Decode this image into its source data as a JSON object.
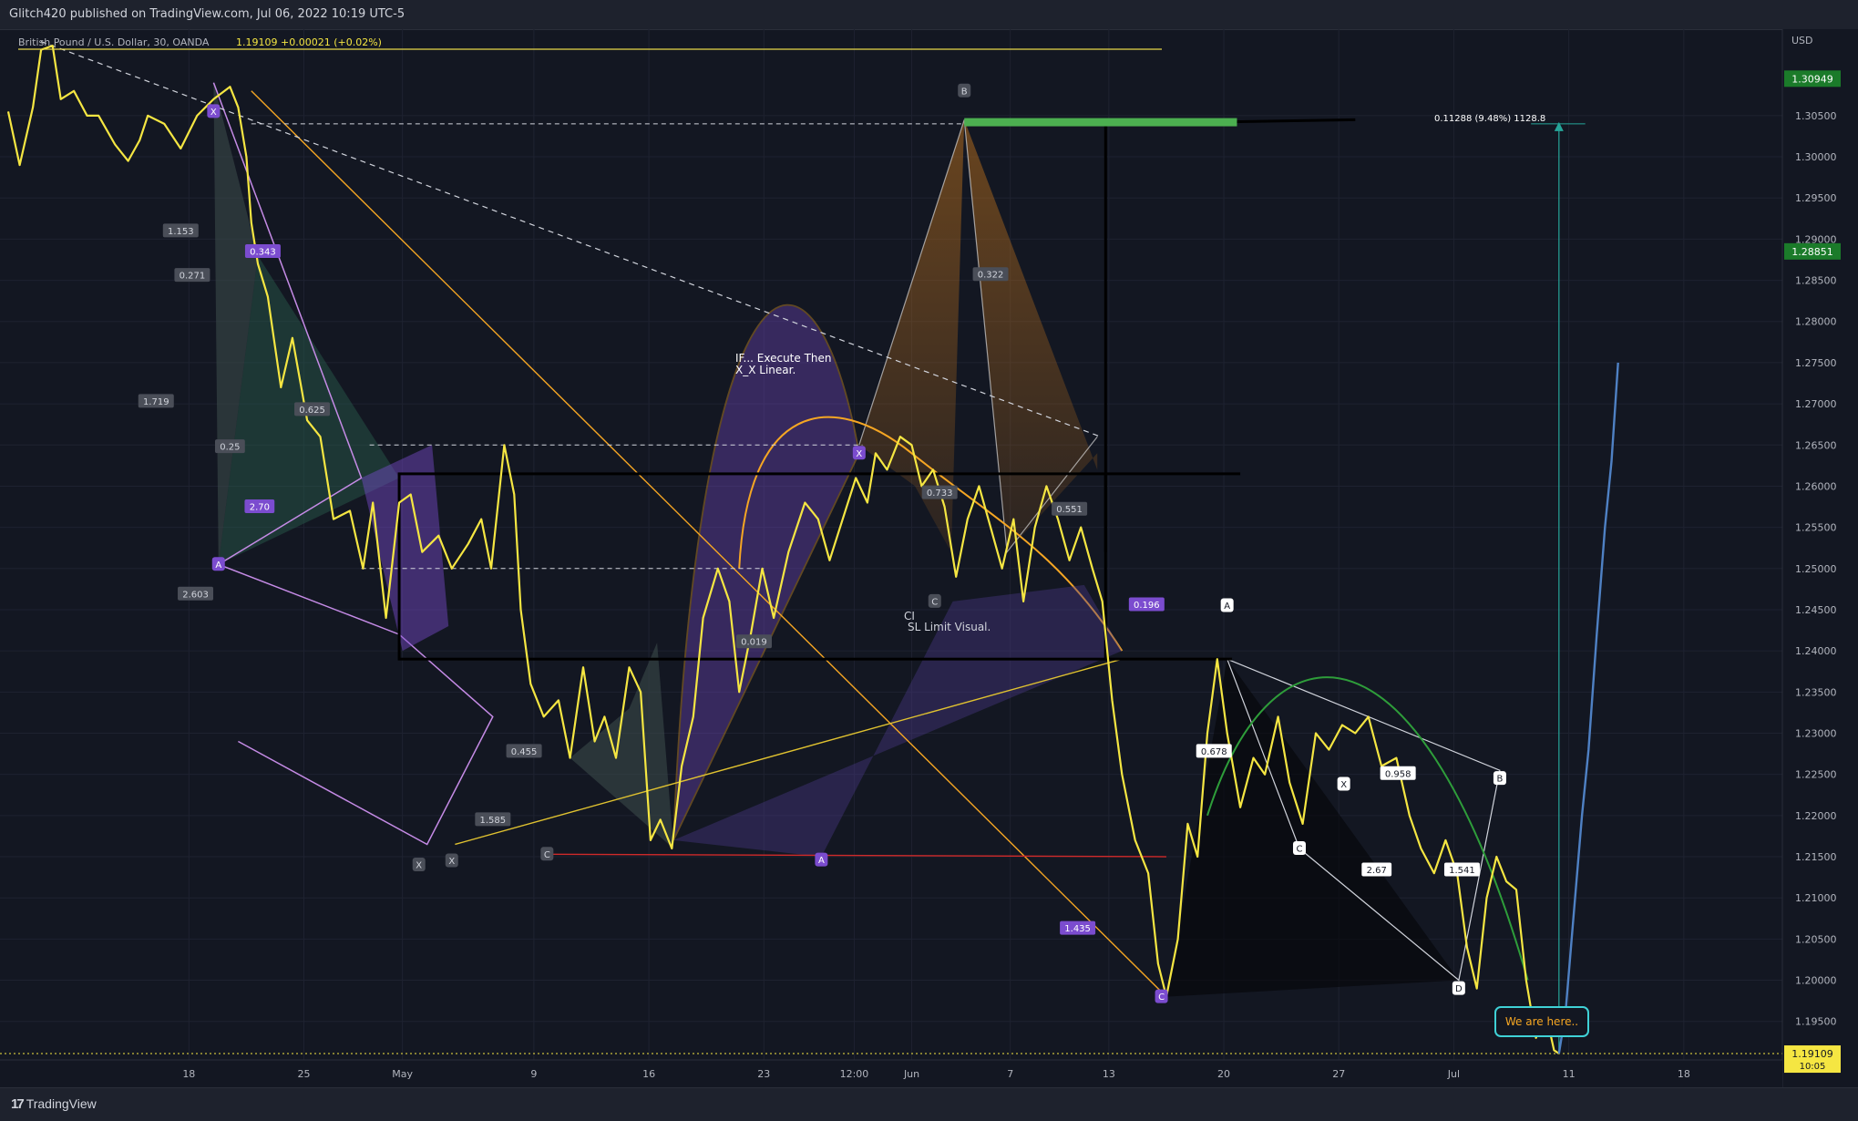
{
  "header": {
    "publish_line": "Glitch420 published on TradingView.com, Jul 06, 2022 10:19 UTC-5"
  },
  "legend": {
    "symbol": "British Pound / U.S. Dollar, 30, OANDA",
    "price": "1.19109",
    "change": "+0.00021 (+0.02%)"
  },
  "footer": {
    "brand": "TradingView"
  },
  "colors": {
    "background": "#131722",
    "price_line": "#f5e642",
    "projection": "#4f81c4",
    "green_label": "#1b7b2a",
    "current_price_label": "#f5e642"
  },
  "annotations": {
    "if_execute_1": "IF... Execute Then",
    "if_execute_2": "X_X Linear.",
    "ci": "CI",
    "sl_limit": "SL Limit Visual.",
    "target_measure": "0.11288 (9.48%) 1128.8",
    "we_are_here": "We are here.."
  },
  "chart_data": {
    "type": "line",
    "title": "British Pound / U.S. Dollar, 30, OANDA",
    "currency": "USD",
    "price_axis": {
      "label": "USD",
      "ylim": [
        1.187,
        1.3155
      ],
      "ticks": [
        "1.30500",
        "1.30000",
        "1.29500",
        "1.29000",
        "1.28500",
        "1.28000",
        "1.27500",
        "1.27000",
        "1.26500",
        "1.26000",
        "1.25500",
        "1.25000",
        "1.24500",
        "1.24000",
        "1.23500",
        "1.23000",
        "1.22500",
        "1.22000",
        "1.21500",
        "1.21000",
        "1.20500",
        "1.20000",
        "1.19500"
      ],
      "price_labels": [
        {
          "text": "1.30949",
          "value": 1.30949
        },
        {
          "text": "1.28851",
          "value": 1.28851
        }
      ],
      "current": {
        "text": "1.19109",
        "value": 1.19109,
        "countdown": "10:05"
      }
    },
    "time_axis": {
      "ticks": [
        "18",
        "25",
        "May",
        "9",
        "16",
        "23",
        "12:00",
        "Jun",
        "7",
        "13",
        "20",
        "27",
        "Jul",
        "11",
        "18"
      ],
      "day_offsets": [
        0,
        7,
        13,
        21,
        28,
        35,
        40.5,
        44,
        50,
        56,
        63,
        70,
        77,
        84,
        91
      ],
      "xlim_days": [
        -11.5,
        97
      ]
    },
    "price_series": {
      "name": "GBPUSD",
      "points": [
        [
          -11,
          1.3055
        ],
        [
          -10.3,
          1.299
        ],
        [
          -9.5,
          1.306
        ],
        [
          -9,
          1.313
        ],
        [
          -8.3,
          1.3135
        ],
        [
          -7.8,
          1.307
        ],
        [
          -7,
          1.308
        ],
        [
          -6.2,
          1.305
        ],
        [
          -5.5,
          1.305
        ],
        [
          -4.5,
          1.3015
        ],
        [
          -3.7,
          1.2995
        ],
        [
          -3,
          1.302
        ],
        [
          -2.5,
          1.305
        ],
        [
          -1.5,
          1.304
        ],
        [
          -0.5,
          1.301
        ],
        [
          0.5,
          1.305
        ],
        [
          1.5,
          1.307
        ],
        [
          2.5,
          1.3085
        ],
        [
          3,
          1.306
        ],
        [
          3.5,
          1.3
        ],
        [
          3.8,
          1.292
        ],
        [
          4.2,
          1.287
        ],
        [
          4.8,
          1.283
        ],
        [
          5.6,
          1.272
        ],
        [
          6.3,
          1.278
        ],
        [
          7.2,
          1.268
        ],
        [
          8,
          1.266
        ],
        [
          8.8,
          1.256
        ],
        [
          9.8,
          1.257
        ],
        [
          10.6,
          1.25
        ],
        [
          11.2,
          1.258
        ],
        [
          12,
          1.244
        ],
        [
          12.8,
          1.258
        ],
        [
          13.5,
          1.259
        ],
        [
          14.2,
          1.252
        ],
        [
          15.2,
          1.254
        ],
        [
          16,
          1.25
        ],
        [
          17,
          1.253
        ],
        [
          17.8,
          1.256
        ],
        [
          18.4,
          1.25
        ],
        [
          19.2,
          1.265
        ],
        [
          19.8,
          1.259
        ],
        [
          20.2,
          1.245
        ],
        [
          20.8,
          1.236
        ],
        [
          21.6,
          1.232
        ],
        [
          22.5,
          1.234
        ],
        [
          23.2,
          1.227
        ],
        [
          24,
          1.238
        ],
        [
          24.7,
          1.229
        ],
        [
          25.3,
          1.232
        ],
        [
          26,
          1.227
        ],
        [
          26.8,
          1.238
        ],
        [
          27.5,
          1.235
        ],
        [
          28.1,
          1.217
        ],
        [
          28.7,
          1.2195
        ],
        [
          29.4,
          1.216
        ],
        [
          30,
          1.226
        ],
        [
          30.7,
          1.232
        ],
        [
          31.3,
          1.244
        ],
        [
          32.2,
          1.25
        ],
        [
          32.9,
          1.246
        ],
        [
          33.5,
          1.235
        ],
        [
          34.2,
          1.242
        ],
        [
          34.9,
          1.25
        ],
        [
          35.6,
          1.244
        ],
        [
          36.5,
          1.252
        ],
        [
          37.5,
          1.258
        ],
        [
          38.3,
          1.256
        ],
        [
          39,
          1.251
        ],
        [
          39.8,
          1.256
        ],
        [
          40.6,
          1.261
        ],
        [
          41.3,
          1.258
        ],
        [
          41.8,
          1.264
        ],
        [
          42.5,
          1.262
        ],
        [
          43.3,
          1.266
        ],
        [
          44,
          1.265
        ],
        [
          44.6,
          1.26
        ],
        [
          45.3,
          1.262
        ],
        [
          46,
          1.2575
        ],
        [
          46.7,
          1.249
        ],
        [
          47.4,
          1.256
        ],
        [
          48.1,
          1.26
        ],
        [
          48.8,
          1.255
        ],
        [
          49.5,
          1.25
        ],
        [
          50.2,
          1.256
        ],
        [
          50.8,
          1.246
        ],
        [
          51.5,
          1.255
        ],
        [
          52.2,
          1.26
        ],
        [
          52.9,
          1.256
        ],
        [
          53.6,
          1.251
        ],
        [
          54.3,
          1.255
        ],
        [
          55,
          1.25
        ],
        [
          55.6,
          1.246
        ],
        [
          56.2,
          1.234
        ],
        [
          56.8,
          1.225
        ],
        [
          57.6,
          1.217
        ],
        [
          58.4,
          1.213
        ],
        [
          59,
          1.202
        ],
        [
          59.5,
          1.198
        ],
        [
          60.2,
          1.205
        ],
        [
          60.8,
          1.219
        ],
        [
          61.4,
          1.215
        ],
        [
          62,
          1.23
        ],
        [
          62.6,
          1.239
        ],
        [
          63.2,
          1.23
        ],
        [
          64,
          1.221
        ],
        [
          64.8,
          1.227
        ],
        [
          65.5,
          1.225
        ],
        [
          66.3,
          1.232
        ],
        [
          67,
          1.224
        ],
        [
          67.8,
          1.219
        ],
        [
          68.6,
          1.23
        ],
        [
          69.4,
          1.228
        ],
        [
          70.2,
          1.231
        ],
        [
          71,
          1.23
        ],
        [
          71.8,
          1.232
        ],
        [
          72.6,
          1.226
        ],
        [
          73.5,
          1.227
        ],
        [
          74.3,
          1.22
        ],
        [
          75,
          1.216
        ],
        [
          75.8,
          1.213
        ],
        [
          76.5,
          1.217
        ],
        [
          77.2,
          1.213
        ],
        [
          77.8,
          1.204
        ],
        [
          78.4,
          1.199
        ],
        [
          79,
          1.21
        ],
        [
          79.6,
          1.215
        ],
        [
          80.2,
          1.212
        ],
        [
          80.8,
          1.211
        ],
        [
          81.4,
          1.2
        ],
        [
          82,
          1.193
        ],
        [
          82.6,
          1.196
        ],
        [
          83.1,
          1.1915
        ],
        [
          83.4,
          1.1911
        ]
      ]
    },
    "projection_series": {
      "points": [
        [
          83.4,
          1.1911
        ],
        [
          83.8,
          1.196
        ],
        [
          84.3,
          1.208
        ],
        [
          84.8,
          1.22
        ],
        [
          85.2,
          1.228
        ],
        [
          85.7,
          1.242
        ],
        [
          86.2,
          1.255
        ],
        [
          86.6,
          1.263
        ],
        [
          87,
          1.275
        ]
      ]
    },
    "pattern_labels": [
      {
        "text": "0.343",
        "x": 4.5,
        "y": 1.2885,
        "style": "purple"
      },
      {
        "text": "0.271",
        "x": 0.2,
        "y": 1.2856,
        "style": "gray"
      },
      {
        "text": "1.153",
        "x": -0.5,
        "y": 1.291,
        "style": "gray"
      },
      {
        "text": "1.719",
        "x": -2.0,
        "y": 1.2703,
        "style": "gray"
      },
      {
        "text": "0.625",
        "x": 7.5,
        "y": 1.2693,
        "style": "gray"
      },
      {
        "text": "0.25",
        "x": 2.5,
        "y": 1.2648,
        "style": "gray"
      },
      {
        "text": "2.70",
        "x": 4.3,
        "y": 1.2575,
        "style": "purple"
      },
      {
        "text": "2.603",
        "x": 0.4,
        "y": 1.2469,
        "style": "gray"
      },
      {
        "text": "0.455",
        "x": 20.4,
        "y": 1.2278,
        "style": "gray"
      },
      {
        "text": "1.585",
        "x": 18.5,
        "y": 1.2195,
        "style": "gray"
      },
      {
        "text": "0.019",
        "x": 34.4,
        "y": 1.2411,
        "style": "gray"
      },
      {
        "text": "0.733",
        "x": 45.7,
        "y": 1.2592,
        "style": "gray"
      },
      {
        "text": "0.551",
        "x": 53.6,
        "y": 1.2572,
        "style": "gray"
      },
      {
        "text": "0.322",
        "x": 48.8,
        "y": 1.2857,
        "style": "gray"
      },
      {
        "text": "0.196",
        "x": 58.3,
        "y": 1.2456,
        "style": "purple"
      },
      {
        "text": "1.435",
        "x": 54.1,
        "y": 1.2063,
        "style": "purple"
      },
      {
        "text": "0.678",
        "x": 62.4,
        "y": 1.2278,
        "style": "white"
      },
      {
        "text": "0.958",
        "x": 73.6,
        "y": 1.2251,
        "style": "white"
      },
      {
        "text": "2.67",
        "x": 72.3,
        "y": 1.2134,
        "style": "white"
      },
      {
        "text": "1.541",
        "x": 77.5,
        "y": 1.2134,
        "style": "white"
      }
    ],
    "point_labels": [
      {
        "text": "X",
        "x": 1.5,
        "y": 1.3055,
        "style": "purple"
      },
      {
        "text": "A",
        "x": 1.8,
        "y": 1.2505,
        "style": "purple"
      },
      {
        "text": "B",
        "x": 47.2,
        "y": 1.308,
        "style": "gray"
      },
      {
        "text": "X",
        "x": 40.8,
        "y": 1.264,
        "style": "purple"
      },
      {
        "text": "C",
        "x": 45.4,
        "y": 1.246,
        "style": "gray"
      },
      {
        "text": "A",
        "x": 38.5,
        "y": 1.2146,
        "style": "purple"
      },
      {
        "text": "C",
        "x": 21.8,
        "y": 1.2153,
        "style": "gray"
      },
      {
        "text": "X",
        "x": 14.0,
        "y": 1.214,
        "style": "gray"
      },
      {
        "text": "X",
        "x": 16.0,
        "y": 1.2145,
        "style": "gray"
      },
      {
        "text": "C",
        "x": 59.2,
        "y": 1.198,
        "style": "purple"
      },
      {
        "text": "A",
        "x": 63.2,
        "y": 1.2455,
        "style": "white"
      },
      {
        "text": "C",
        "x": 67.6,
        "y": 1.216,
        "style": "white"
      },
      {
        "text": "X",
        "x": 70.3,
        "y": 1.2238,
        "style": "white"
      },
      {
        "text": "D",
        "x": 77.3,
        "y": 1.199,
        "style": "white"
      },
      {
        "text": "B",
        "x": 79.8,
        "y": 1.2245,
        "style": "white"
      }
    ],
    "grid": true
  }
}
